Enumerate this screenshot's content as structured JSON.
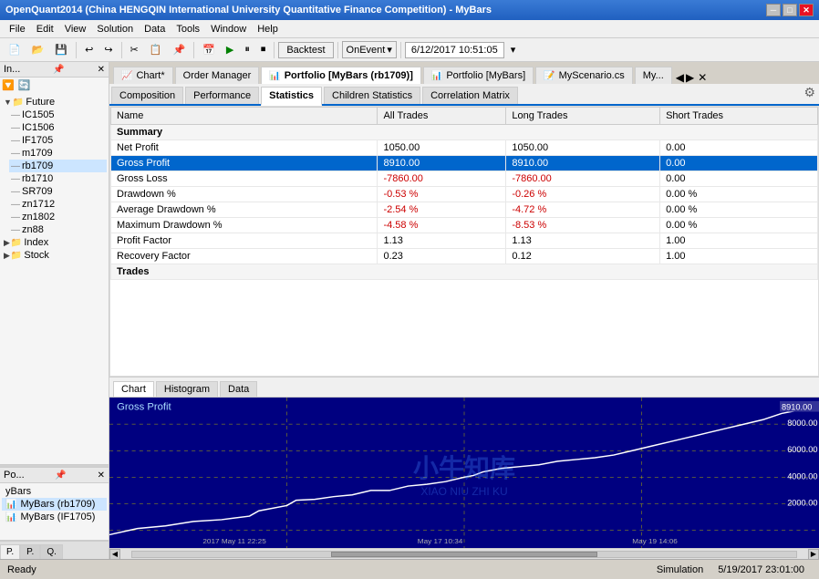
{
  "titlebar": {
    "title": "OpenQuant2014 (China HENGQIN International University Quantitative Finance Competition) - MyBars",
    "min_label": "─",
    "max_label": "□",
    "close_label": "✕"
  },
  "menubar": {
    "items": [
      "File",
      "Edit",
      "View",
      "Solution",
      "Data",
      "Tools",
      "Window",
      "Help"
    ]
  },
  "toolbar": {
    "backtest_label": "Backtest",
    "onevent_label": "OnEvent",
    "date_label": "6/12/2017  10:51:05"
  },
  "left_panel": {
    "header": "In...",
    "tree": {
      "future_label": "Future",
      "items": [
        "IC1505",
        "IC1506",
        "IF1705",
        "m1709",
        "rb1709",
        "rb1710",
        "SR709",
        "zn1712",
        "zn1802",
        "zn88"
      ],
      "index_label": "Index",
      "stock_label": "Stock"
    }
  },
  "portfolio_panel": {
    "header": "Po...",
    "items": [
      "yBars",
      "MyBars (rb1709)",
      "MyBars (IF1705)"
    ]
  },
  "left_tabs": [
    "P.",
    "P.",
    "Q."
  ],
  "doc_tabs": [
    {
      "label": "Chart*",
      "active": false
    },
    {
      "label": "Order Manager",
      "active": false
    },
    {
      "label": "Portfolio [MyBars (rb1709)]",
      "active": true
    },
    {
      "label": "Portfolio [MyBars]",
      "active": false
    },
    {
      "label": "MyScenario.cs",
      "active": false
    },
    {
      "label": "My...",
      "active": false
    }
  ],
  "content_tabs": [
    {
      "label": "Composition",
      "active": false
    },
    {
      "label": "Performance",
      "active": false
    },
    {
      "label": "Statistics",
      "active": true
    },
    {
      "label": "Children Statistics",
      "active": false
    },
    {
      "label": "Correlation Matrix",
      "active": false
    }
  ],
  "statistics": {
    "headers": [
      "Name",
      "All Trades",
      "Long Trades",
      "Short Trades"
    ],
    "sections": [
      {
        "section_name": "Summary",
        "rows": [
          {
            "name": "Net Profit",
            "all": "1050.00",
            "long": "1050.00",
            "short": "0.00",
            "selected": false,
            "all_color": "black",
            "long_color": "black",
            "short_color": "black"
          },
          {
            "name": "Gross Profit",
            "all": "8910.00",
            "long": "8910.00",
            "short": "0.00",
            "selected": true,
            "all_color": "white",
            "long_color": "white",
            "short_color": "white"
          },
          {
            "name": "Gross Loss",
            "all": "-7860.00",
            "long": "-7860.00",
            "short": "0.00",
            "selected": false,
            "all_color": "red",
            "long_color": "red",
            "short_color": "black"
          },
          {
            "name": "Drawdown %",
            "all": "-0.53 %",
            "long": "-0.26 %",
            "short": "0.00 %",
            "selected": false,
            "all_color": "red",
            "long_color": "red",
            "short_color": "black"
          },
          {
            "name": "Average Drawdown %",
            "all": "-2.54 %",
            "long": "-4.72 %",
            "short": "0.00 %",
            "selected": false,
            "all_color": "red",
            "long_color": "red",
            "short_color": "black"
          },
          {
            "name": "Maximum Drawdown %",
            "all": "-4.58 %",
            "long": "-8.53 %",
            "short": "0.00 %",
            "selected": false,
            "all_color": "red",
            "long_color": "red",
            "short_color": "black"
          },
          {
            "name": "Profit Factor",
            "all": "1.13",
            "long": "1.13",
            "short": "1.00",
            "selected": false,
            "all_color": "black",
            "long_color": "black",
            "short_color": "black"
          },
          {
            "name": "Recovery Factor",
            "all": "0.23",
            "long": "0.12",
            "short": "1.00",
            "selected": false,
            "all_color": "black",
            "long_color": "black",
            "short_color": "black"
          }
        ]
      },
      {
        "section_name": "Trades",
        "rows": []
      }
    ]
  },
  "chart_tabs": [
    {
      "label": "Chart",
      "active": true
    },
    {
      "label": "Histogram",
      "active": false
    },
    {
      "label": "Data",
      "active": false
    }
  ],
  "chart": {
    "title": "Gross Profit",
    "y_labels": [
      "8000.00",
      "6000.00",
      "4000.00",
      "2000.00"
    ],
    "y_end_label": "8910.00",
    "x_labels": [
      "2017 May 11 22:25",
      "May 17 10:34",
      "May 19 14:06"
    ],
    "bg_color": "#000080",
    "line_color": "white"
  },
  "statusbar": {
    "ready_label": "Ready",
    "simulation_label": "Simulation",
    "date_label": "5/19/2017  23:01:00"
  }
}
